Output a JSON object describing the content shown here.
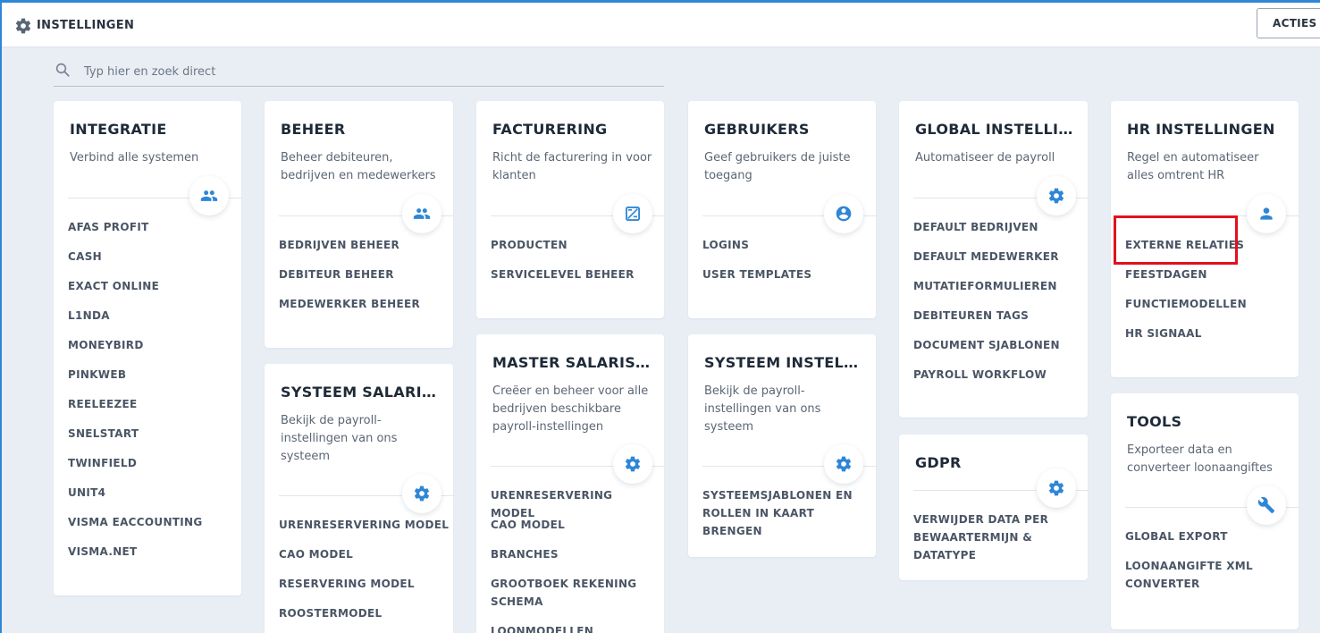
{
  "header": {
    "title": "INSTELLINGEN",
    "actions_label": "ACTIES"
  },
  "search": {
    "placeholder": "Typ hier en zoek direct"
  },
  "cards": {
    "integratie": {
      "title": "INTEGRATIE",
      "desc": "Verbind alle systemen",
      "icon": "users-icon",
      "links": [
        "AFAS PROFIT",
        "CASH",
        "EXACT ONLINE",
        "L1NDA",
        "MONEYBIRD",
        "PINKWEB",
        "REELEEZEE",
        "SNELSTART",
        "TWINFIELD",
        "UNIT4",
        "VISMA EACCOUNTING",
        "VISMA.NET"
      ]
    },
    "beheer": {
      "title": "BEHEER",
      "desc": "Beheer debiteuren, bedrijven en medewerkers",
      "icon": "users-icon",
      "links": [
        "BEDRIJVEN BEHEER",
        "DEBITEUR BEHEER",
        "MEDEWERKER BEHEER"
      ]
    },
    "systeem_salarisi": {
      "title": "SYSTEEM SALARISI...",
      "desc": "Bekijk de payroll-instellingen van ons systeem",
      "icon": "gear-icon",
      "links": [
        "URENRESERVERING MODEL",
        "CAO MODEL",
        "RESERVERING MODEL",
        "ROOSTERMODEL"
      ]
    },
    "facturering": {
      "title": "FACTURERING",
      "desc": "Richt de facturering in voor klanten",
      "icon": "invoice-icon",
      "links": [
        "PRODUCTEN",
        "SERVICELEVEL BEHEER"
      ]
    },
    "master_salarisin": {
      "title": "MASTER SALARISIN...",
      "desc": "Creëer en beheer voor alle bedrijven beschikbare payroll-instellingen",
      "icon": "gear-icon",
      "links": [
        "URENRESERVERING MODEL",
        "CAO MODEL",
        "BRANCHES",
        "GROOTBOEK REKENING SCHEMA",
        "LOONMODELLEN"
      ]
    },
    "gebruikers": {
      "title": "GEBRUIKERS",
      "desc": "Geef gebruikers de juiste toegang",
      "icon": "user-circle-icon",
      "links": [
        "LOGINS",
        "USER TEMPLATES"
      ]
    },
    "systeem_instelli": {
      "title": "SYSTEEM INSTELLI...",
      "desc": "Bekijk de payroll-instellingen van ons systeem",
      "icon": "gear-icon",
      "links": [
        "SYSTEEMSJABLONEN EN ROLLEN IN KAART BRENGEN"
      ]
    },
    "global_instellin": {
      "title": "GLOBAL INSTELLIN...",
      "desc": "Automatiseer de payroll",
      "icon": "gear-icon",
      "links": [
        "DEFAULT BEDRIJVEN",
        "DEFAULT MEDEWERKER",
        "MUTATIEFORMULIEREN",
        "DEBITEUREN TAGS",
        "DOCUMENT SJABLONEN",
        "PAYROLL WORKFLOW"
      ]
    },
    "gdpr": {
      "title": "GDPR",
      "desc": "",
      "icon": "gear-icon",
      "links": [
        "VERWIJDER DATA PER BEWAARTERMIJN & DATATYPE"
      ]
    },
    "hr_instellingen": {
      "title": "HR INSTELLINGEN",
      "desc": "Regel en automatiseer alles omtrent HR",
      "icon": "person-icon",
      "links": [
        "EXTERNE RELATIES",
        "FEESTDAGEN",
        "FUNCTIEMODELLEN",
        "HR SIGNAAL"
      ]
    },
    "tools": {
      "title": "TOOLS",
      "desc": "Exporteer data en converteer loonaangiftes",
      "icon": "wrench-icon",
      "links": [
        "GLOBAL EXPORT",
        "LOONAANGIFTE XML CONVERTER"
      ]
    }
  },
  "colors": {
    "accent": "#2f86d6",
    "highlight": "#e3101c",
    "background": "#e9eef5"
  }
}
